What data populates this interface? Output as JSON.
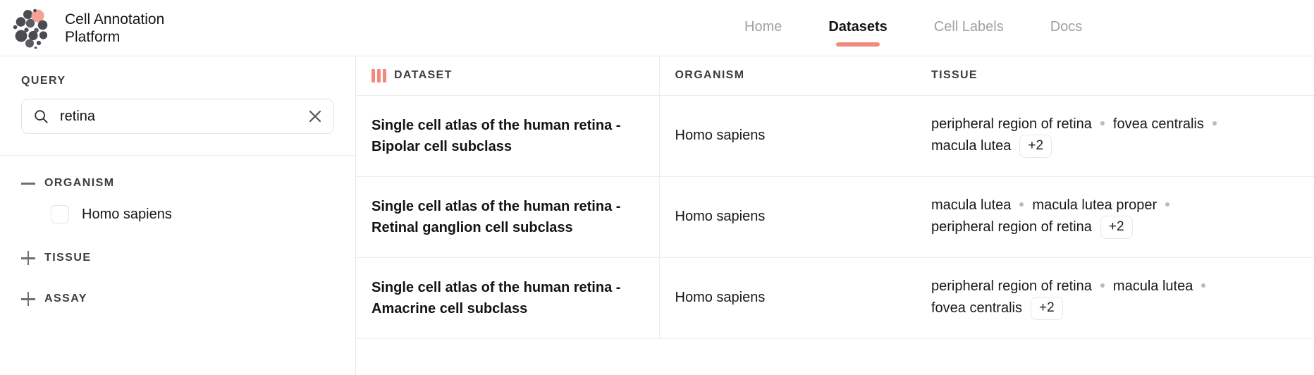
{
  "brand": {
    "name": "Cell Annotation Platform",
    "logo_icon": "cell-cluster-logo",
    "accent_color": "#f08b7d"
  },
  "nav": {
    "items": [
      {
        "label": "Home",
        "active": false
      },
      {
        "label": "Datasets",
        "active": true
      },
      {
        "label": "Cell Labels",
        "active": false
      },
      {
        "label": "Docs",
        "active": false
      }
    ]
  },
  "sidebar": {
    "query_label": "QUERY",
    "search": {
      "value": "retina",
      "placeholder": "Search",
      "search_icon": "search-icon",
      "clear_icon": "close-icon"
    },
    "facets": [
      {
        "title": "ORGANISM",
        "expanded": true,
        "toggle_icon": "minus-icon",
        "options": [
          {
            "label": "Homo sapiens",
            "checked": false
          }
        ]
      },
      {
        "title": "TISSUE",
        "expanded": false,
        "toggle_icon": "plus-icon",
        "options": []
      },
      {
        "title": "ASSAY",
        "expanded": false,
        "toggle_icon": "plus-icon",
        "options": []
      }
    ]
  },
  "table": {
    "columns_icon": "columns-icon",
    "headers": [
      "DATASET",
      "ORGANISM",
      "TISSUE"
    ],
    "rows": [
      {
        "dataset": "Single cell atlas of the human retina - Bipolar cell subclass",
        "organism": "Homo sapiens",
        "tissues": [
          "peripheral region of retina",
          "fovea centralis",
          "macula lutea"
        ],
        "tissue_more": "+2"
      },
      {
        "dataset": "Single cell atlas of the human retina - Retinal ganglion cell subclass",
        "organism": "Homo sapiens",
        "tissues": [
          "macula lutea",
          "macula lutea proper",
          "peripheral region of retina"
        ],
        "tissue_more": "+2"
      },
      {
        "dataset": "Single cell atlas of the human retina - Amacrine cell subclass",
        "organism": "Homo sapiens",
        "tissues": [
          "peripheral region of retina",
          "macula lutea",
          "fovea centralis"
        ],
        "tissue_more": "+2"
      }
    ]
  }
}
